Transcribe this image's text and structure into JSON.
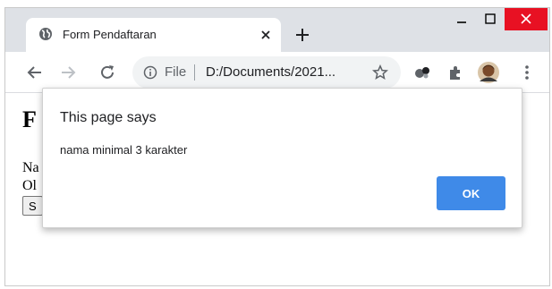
{
  "window": {
    "tab_title": "Form Pendaftaran",
    "controls": [
      "minimize",
      "maximize",
      "close"
    ]
  },
  "toolbar": {
    "scheme_label": "File",
    "url": "D:/Documents/2021...",
    "icons": [
      "back-arrow",
      "forward-arrow",
      "reload",
      "info",
      "star",
      "extension-shapes",
      "puzzle",
      "avatar",
      "three-dot-menu"
    ]
  },
  "page": {
    "heading_visible": "F",
    "label_nama_visible": "Na",
    "label_olahraga_visible": "Ol",
    "submit_visible": "S"
  },
  "alert": {
    "title": "This page says",
    "message": "nama minimal 3 karakter",
    "ok_label": "OK"
  },
  "colors": {
    "tabstrip": "#dee1e6",
    "close_button": "#e81123",
    "ok_button": "#3f8ae8"
  }
}
